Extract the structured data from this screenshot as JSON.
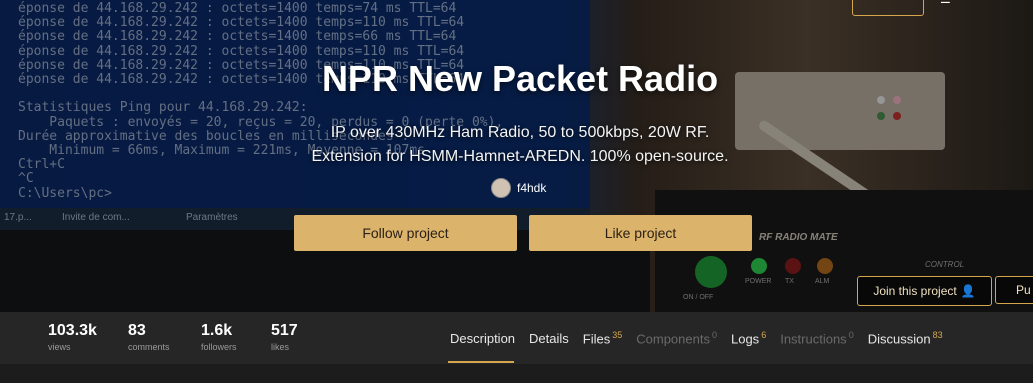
{
  "hero": {
    "title": "NPR New Packet Radio",
    "subtitle_line1": "IP over 430MHz Ham Radio, 50 to 500kbps, 20W RF.",
    "subtitle_line2": "Extension for HSMM-Hamnet-AREDN. 100% open-source.",
    "author": "f4hdk",
    "terminal_text": "éponse de 44.168.29.242 : octets=1400 temps=74 ms TTL=64\néponse de 44.168.29.242 : octets=1400 temps=110 ms TTL=64\néponse de 44.168.29.242 : octets=1400 temps=66 ms TTL=64\néponse de 44.168.29.242 : octets=1400 temps=110 ms TTL=64\néponse de 44.168.29.242 : octets=1400 temps=110 ms TTL=64\néponse de 44.168.29.242 : octets=1400 temps=110 ms TTL=64\n\nStatistiques Ping pour 44.168.29.242:\n    Paquets : envoyés = 20, reçus = 20, perdus = 0 (perte 0%),\nDurée approximative des boucles en millisecondes :\n    Minimum = 66ms, Maximum = 221ms, Moyenne = 107ms\nCtrl+C\n^C\nC:\\Users\\pc>",
    "taskbar_items": [
      "17.p...",
      "Invite de com...",
      "Paramètres"
    ],
    "radio_label": "RF RADIO MATE",
    "radio_labels": [
      "POWER",
      "TX",
      "ALM",
      "CONTROL",
      "ON / OFF"
    ]
  },
  "actions": {
    "follow_label": "Follow project",
    "like_label": "Like project",
    "join_label": "Join this project",
    "publish_label": "Pu"
  },
  "stats": [
    {
      "value": "103.3k",
      "label": "views"
    },
    {
      "value": "83",
      "label": "comments"
    },
    {
      "value": "1.6k",
      "label": "followers"
    },
    {
      "value": "517",
      "label": "likes"
    }
  ],
  "tabs": [
    {
      "label": "Description",
      "count": "",
      "active": true
    },
    {
      "label": "Details",
      "count": ""
    },
    {
      "label": "Files",
      "count": "35"
    },
    {
      "label": "Components",
      "count": "0",
      "disabled": true
    },
    {
      "label": "Logs",
      "count": "6"
    },
    {
      "label": "Instructions",
      "count": "0",
      "disabled": true
    },
    {
      "label": "Discussion",
      "count": "83"
    }
  ],
  "colors": {
    "accent": "#d6a64f",
    "button_fill": "#dcb36b",
    "stats_bg": "#262626"
  }
}
